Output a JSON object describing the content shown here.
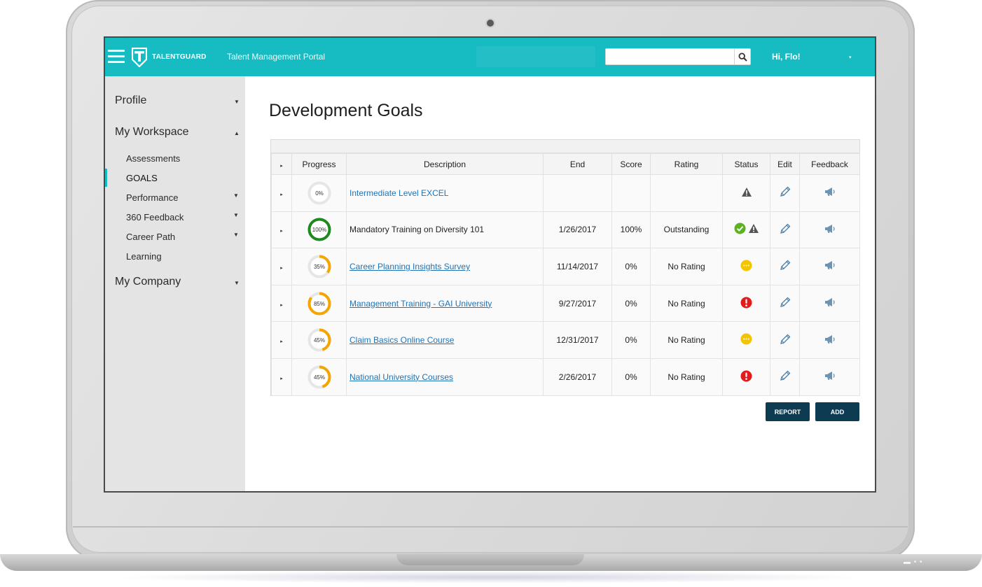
{
  "header": {
    "logo_text": "TALENTGUARD",
    "portal_title": "Talent Management Portal",
    "search": {
      "value": "",
      "placeholder": ""
    },
    "user_greeting": "Hi, Flo!",
    "user_caret": "▾"
  },
  "sidebar": {
    "items": [
      {
        "label": "Profile",
        "caret": "▼"
      },
      {
        "label": "My Workspace",
        "caret": "▲"
      },
      {
        "label": "My Company",
        "caret": "▼"
      }
    ],
    "sub_items": [
      {
        "label": "Assessments",
        "caret": ""
      },
      {
        "label": "GOALS",
        "caret": ""
      },
      {
        "label": "Performance",
        "caret": "▼"
      },
      {
        "label": "360 Feedback",
        "caret": "▼"
      },
      {
        "label": "Career Path",
        "caret": "▼"
      },
      {
        "label": "Learning",
        "caret": ""
      }
    ]
  },
  "main": {
    "title": "Development Goals",
    "columns": [
      "▸",
      "Progress",
      "Description",
      "End",
      "Score",
      "Rating",
      "Status",
      "Edit",
      "Feedback"
    ],
    "rows": [
      {
        "expand": "▸",
        "progress": 0,
        "progress_label": "0%",
        "progress_color": "#cfcfcf",
        "description": "Intermediate Level EXCEL",
        "desc_style": "link",
        "end": "",
        "score": "",
        "rating": "",
        "status": [
          "warning"
        ]
      },
      {
        "expand": "▸",
        "progress": 100,
        "progress_label": "100%",
        "progress_color": "#1e8a1e",
        "description": "Mandatory Training on Diversity 101",
        "desc_style": "plain",
        "end": "1/26/2017",
        "score": "100%",
        "rating": "Outstanding",
        "status": [
          "check",
          "warning"
        ]
      },
      {
        "expand": "▸",
        "progress": 35,
        "progress_label": "35%",
        "progress_color": "#f5a500",
        "description": "Career Planning Insights Survey",
        "desc_style": "link-underline",
        "end": "11/14/2017",
        "score": "0%",
        "rating": "No Rating",
        "status": [
          "in-progress"
        ]
      },
      {
        "expand": "▸",
        "progress": 85,
        "progress_label": "85%",
        "progress_color": "#f5a500",
        "description": "Management Training - GAI University",
        "desc_style": "link-underline",
        "end": "9/27/2017",
        "score": "0%",
        "rating": "No Rating",
        "status": [
          "alert"
        ]
      },
      {
        "expand": "▸",
        "progress": 45,
        "progress_label": "45%",
        "progress_color": "#f5a500",
        "description": "Claim Basics Online Course",
        "desc_style": "link-underline",
        "end": "12/31/2017",
        "score": "0%",
        "rating": "No Rating",
        "status": [
          "in-progress"
        ]
      },
      {
        "expand": "▸",
        "progress": 45,
        "progress_label": "45%",
        "progress_color": "#f5a500",
        "description": "National University Courses",
        "desc_style": "link-underline",
        "end": "2/26/2017",
        "score": "0%",
        "rating": "No Rating",
        "status": [
          "alert"
        ]
      }
    ],
    "buttons": {
      "report": "REPORT",
      "add": "ADD"
    }
  },
  "colors": {
    "header_bg": "#17bcc3",
    "sidebar_bg": "#e4e4e4",
    "button_bg": "#0d3b52",
    "link": "#1f73b7",
    "status_check": "#5db31f",
    "status_alert": "#e31b1b",
    "status_in_progress": "#f2c500",
    "status_warning": "#555555"
  },
  "icons": {
    "menu": "hamburger-icon",
    "search": "search-icon",
    "edit": "pencil-icon",
    "feedback": "megaphone-icon"
  }
}
